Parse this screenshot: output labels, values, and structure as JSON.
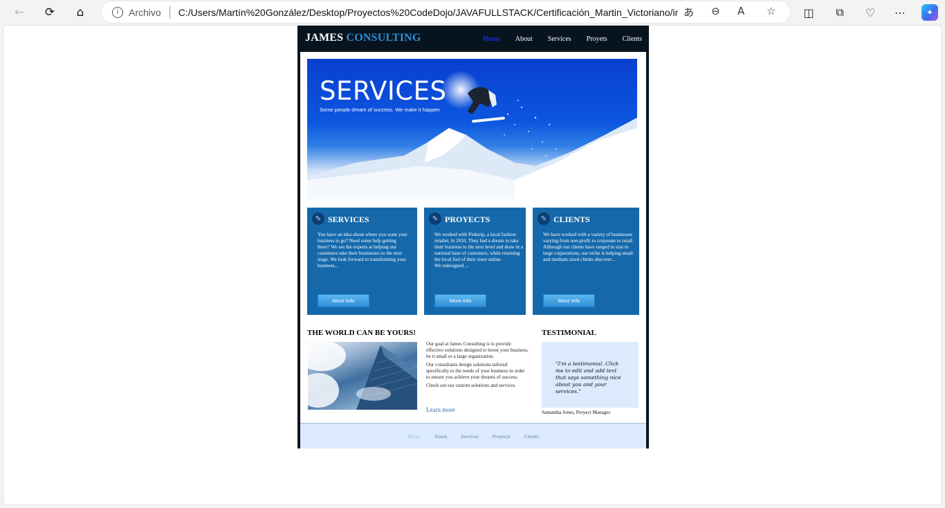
{
  "browser": {
    "back_icon": "arrow-left-icon",
    "reload_icon": "reload-icon",
    "home_icon": "home-icon",
    "scheme": "Archivo",
    "url": "C:/Users/Martín%20González/Desktop/Proyectos%20CodeDojo/JAVAFULLSTACK/Certificación_Martin_Victoriano/in..."
  },
  "site": {
    "logo_main": "JAMES",
    "logo_accent": "CONSULTING",
    "nav": [
      "Home",
      "About",
      "Services",
      "Proyets",
      "Clients"
    ],
    "hero_title": "SERVICES",
    "hero_subtitle": "Some people dream of success. We make it happen",
    "cards": [
      {
        "title": "SERVICES",
        "text": "You have an idea about where you want your business to go? Need some help getting there? We are the experts at helping our customers take their businesses to the next stage. We look forward to transforming your business...",
        "button": "More Info"
      },
      {
        "title": "PROYECTS",
        "text": "We worked with Pinktrip, a local fashion retailer, in 2010. They had a dream to take their business to the next level and draw in a national base of customers, while retaining the local feel of their store online.",
        "text2": "We redesigned ...",
        "button": "More Info"
      },
      {
        "title": "CLIENTS",
        "text": "We have worked with a variety of businesses varying from non-profit to corporate to retail. Although our clients have ranged in size to large corporations, our niche is helping small and medium sized clients discover...",
        "button": "More Info"
      }
    ],
    "world_title": "THE WORLD CAN BE YOURS!",
    "world_p1": "Our goal at James Consulting is to provide effective solutions designed to boost your business, be it small or a large organization.",
    "world_p2": "Our consultants design solutions tailored specifically to the needs of your business in order to ensure you achieve your dreams of success.",
    "world_p3": "Check out our custom solutions and services.",
    "learn_more": "Learn more",
    "testimonial_title": "TESTIMONIAL",
    "testimonial_quote": "\"I'm a testimonial. Click me to edit and add text that says something nice about you and your services.\"",
    "testimonial_author": "Samantha Jones, Proyect Manager.",
    "footer_nav": [
      "Home",
      "About",
      "Services",
      "Proyects",
      "Clients"
    ]
  }
}
